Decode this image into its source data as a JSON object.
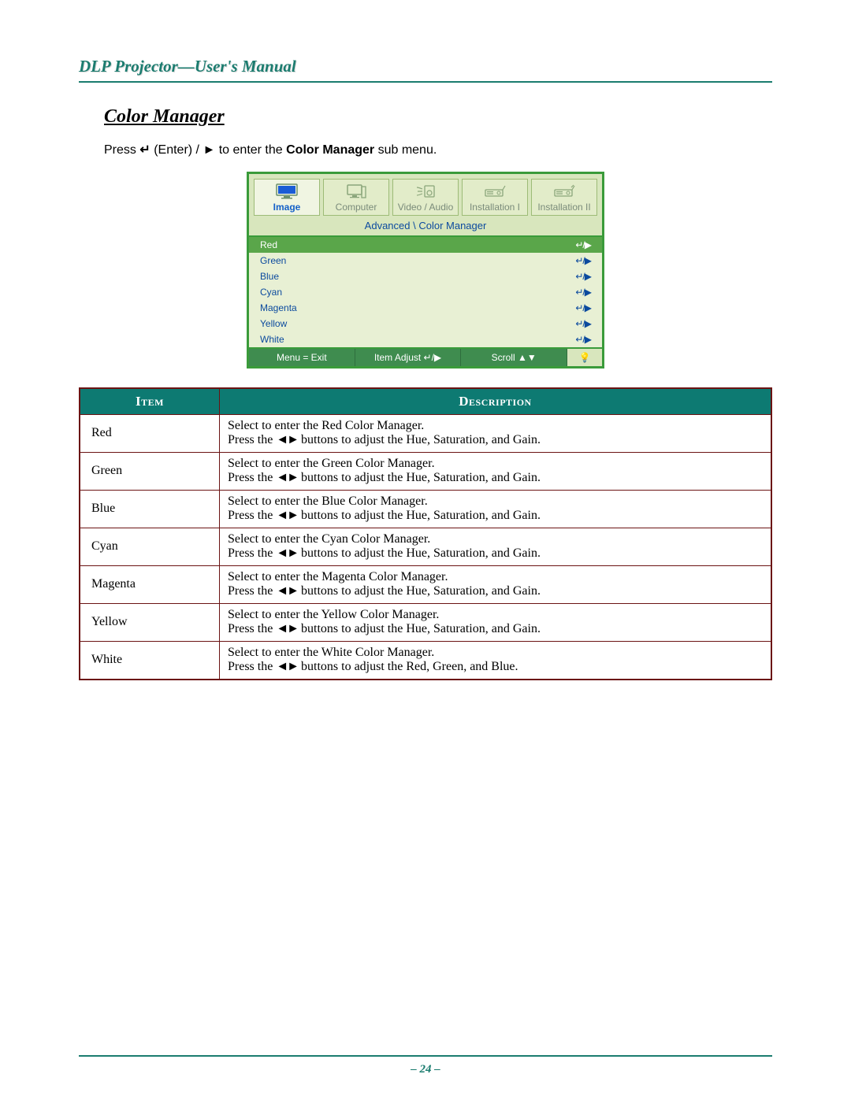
{
  "header": {
    "title": "DLP Projector—User's Manual"
  },
  "section_title": "Color Manager",
  "intro": {
    "prefix": "Press ",
    "enter_symbol": "↵",
    "mid": " (Enter) / ",
    "play_symbol": "►",
    "mid2": " to enter the ",
    "bold": "Color Manager",
    "suffix": " sub menu."
  },
  "osd": {
    "tabs": [
      {
        "label": "Image",
        "active": true,
        "icon": "monitor"
      },
      {
        "label": "Computer",
        "active": false,
        "icon": "computer"
      },
      {
        "label": "Video / Audio",
        "active": false,
        "icon": "speaker"
      },
      {
        "label": "Installation I",
        "active": false,
        "icon": "projector"
      },
      {
        "label": "Installation II",
        "active": false,
        "icon": "projector2"
      }
    ],
    "breadcrumb": "Advanced \\ Color Manager",
    "rows": [
      {
        "label": "Red",
        "selected": true
      },
      {
        "label": "Green",
        "selected": false
      },
      {
        "label": "Blue",
        "selected": false
      },
      {
        "label": "Cyan",
        "selected": false
      },
      {
        "label": "Magenta",
        "selected": false
      },
      {
        "label": "Yellow",
        "selected": false
      },
      {
        "label": "White",
        "selected": false
      }
    ],
    "row_icon": "↵/▶",
    "footer": {
      "exit": "Menu = Exit",
      "adjust": "Item Adjust ↵/▶",
      "scroll": "Scroll ▲▼",
      "bulb": "💡"
    }
  },
  "table": {
    "head": {
      "item": "Item",
      "desc": "Description"
    },
    "arrows": "◄►",
    "rows": [
      {
        "item": "Red",
        "line1": "Select to enter the Red Color Manager.",
        "line2a": "Press the ",
        "line2b": " buttons to adjust the Hue, Saturation, and Gain."
      },
      {
        "item": "Green",
        "line1": "Select to enter the Green Color Manager.",
        "line2a": "Press the ",
        "line2b": " buttons to adjust the Hue, Saturation, and Gain."
      },
      {
        "item": "Blue",
        "line1": "Select to enter the Blue Color Manager.",
        "line2a": "Press the ",
        "line2b": " buttons to adjust the Hue, Saturation, and Gain."
      },
      {
        "item": "Cyan",
        "line1": "Select to enter the Cyan Color Manager.",
        "line2a": "Press the ",
        "line2b": " buttons to adjust the Hue, Saturation, and Gain."
      },
      {
        "item": "Magenta",
        "line1": "Select to enter the Magenta Color Manager.",
        "line2a": "Press the ",
        "line2b": " buttons to adjust the Hue, Saturation, and Gain."
      },
      {
        "item": "Yellow",
        "line1": "Select to enter the Yellow Color Manager.",
        "line2a": "Press the ",
        "line2b": " buttons to adjust the Hue, Saturation, and Gain."
      },
      {
        "item": "White",
        "line1": "Select to enter the White Color Manager.",
        "line2a": "Press the ",
        "line2b": " buttons to adjust the Red, Green, and Blue."
      }
    ]
  },
  "page_number": "– 24 –"
}
